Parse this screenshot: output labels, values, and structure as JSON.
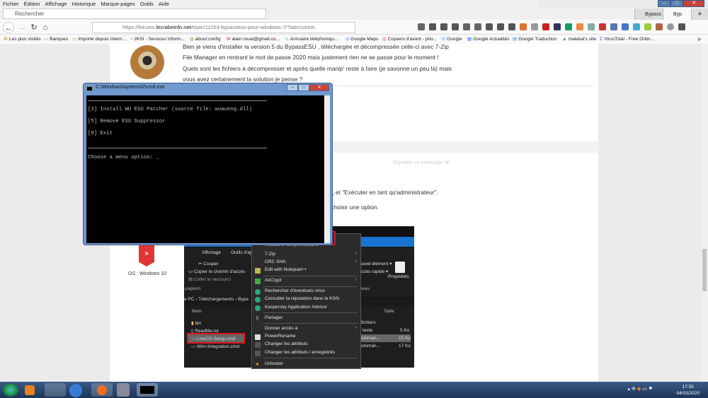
{
  "menu": [
    "Fichier",
    "Édition",
    "Affichage",
    "Historique",
    "Marque-pages",
    "Outils",
    "Aide"
  ],
  "search": {
    "placeholder": "Rechercher"
  },
  "tabs": [
    "Bypass",
    "Byp"
  ],
  "url": {
    "prefix": "https://forums.",
    "domain": "lecrabeinfo.net",
    "path": "/topic/11153-bypassesu-pour-windows-7/?tab=comm"
  },
  "bookmarks": [
    "Les plus visités",
    "Banques",
    "Importé depuis Intern...",
    "2KSI - Services Inform...",
    "about:config",
    "alain.rouat@gmail.co...",
    "Annuaire téléphoniqu...",
    "Google Maps",
    "Copains d'avant - pho...",
    "Google",
    "Google Actualités",
    "Google Traduction",
    "malekal's site",
    "VirusTotal - Free Onlin..."
  ],
  "post": {
    "lines": [
      "Bien je viens d'installer la version 5 du BypassESU , téléchargée et décompressée celle-ci avec 7-Zip",
      "File Manager en rentrant le mot de passe 2020 mais justement rien ne se passe pour le moment !",
      "Quels sont les fichiers à décompresser et après quelle manip' reste à faire (je savonne un peu là) mais",
      "vous avez certainement la solution je pense ?"
    ]
  },
  "reply": {
    "report": "Signaler ce message",
    "line1": "it, et \"Exécuter en tant qu'administrateur\".",
    "line2": "choisir une option.",
    "os": "OS : Windows 10"
  },
  "cmd": {
    "title": "C:\\Windows\\system32\\cmd.exe",
    "lines": [
      "[3] Install WU ESU Patcher (source file: wuaueng.dll)",
      "[5] Remove ESU Suppressor",
      "[9] Exit",
      "Choose a menu option: _"
    ]
  },
  "explorer": {
    "ribbon_tabs": [
      "Affichage",
      "Outils d'ap"
    ],
    "clipboard": [
      "Couper",
      "Copier le chemin d'accès",
      "Coller le raccourci"
    ],
    "group": "-papiers",
    "new_item": "ouvel élément ▾",
    "quick": "ccès rapide ▾",
    "props": "Propriétés",
    "group2": "veau",
    "breadcrumb": "e PC  ›  Téléchargements  ›  Bypa",
    "col_name": "Nom",
    "col_size": "Taille",
    "files": [
      {
        "name": "bin",
        "type": "fichiers",
        "size": ""
      },
      {
        "name": "ReadMe.txt",
        "type": "texte",
        "size": "5 Ko"
      },
      {
        "name": "LiveOS-Setup.cmd",
        "type": "omman...",
        "size": "15 Ko"
      },
      {
        "name": "Wim-Integration.cmd",
        "type": "omman...",
        "size": "17 Ko"
      }
    ]
  },
  "context_menu": [
    "Restaurer les permissions",
    "7-Zip",
    "CRC SHA",
    "Edit with Notepad++",
    "AxCrypt",
    "Rechercher d'éventuels virus",
    "Consulter la réputation dans le KSN",
    "Kaspersky Application Advisor",
    "Partager",
    "Donner accès à",
    "PowerRename",
    "Changer les attributs",
    "Changer les attributs / enregistrés",
    "Unlocker"
  ],
  "clock": {
    "time": "17:55",
    "date": "04/03/2020"
  }
}
